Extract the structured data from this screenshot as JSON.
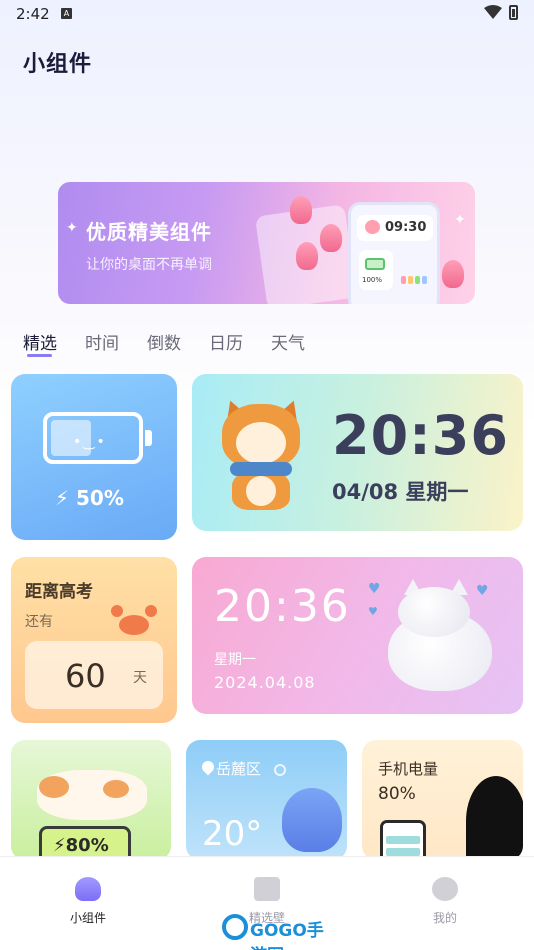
{
  "status_bar": {
    "time": "2:42",
    "notif_icon": "A"
  },
  "page": {
    "title": "小组件"
  },
  "banner": {
    "title": "优质精美组件",
    "subtitle": "让你的桌面不再单调",
    "preview_time": "09:30",
    "preview_battery": "100%"
  },
  "tabs": [
    {
      "label": "精选",
      "active": true
    },
    {
      "label": "时间",
      "active": false
    },
    {
      "label": "倒数",
      "active": false
    },
    {
      "label": "日历",
      "active": false
    },
    {
      "label": "天气",
      "active": false
    }
  ],
  "widgets": {
    "battery": {
      "face": "•‿•",
      "label": "⚡ 50%"
    },
    "clock": {
      "time": "20:36",
      "date": "04/08 星期一"
    },
    "countdown": {
      "title": "距离高考",
      "still": "还有",
      "number": "60",
      "unit": "天"
    },
    "pink_clock": {
      "time": "20:36",
      "weekday": "星期一",
      "date": "2024.04.08"
    },
    "cat_battery": {
      "label": "⚡80%"
    },
    "weather": {
      "location": "岳麓区",
      "temp": "20°"
    },
    "phone_battery": {
      "title": "手机电量",
      "percent": "80%"
    }
  },
  "bottom_nav": [
    {
      "label": "小组件",
      "icon": "widget-icon",
      "active": true
    },
    {
      "label": "精选壁",
      "icon": "wallpaper-icon",
      "active": false
    },
    {
      "label": "我的",
      "icon": "profile-icon",
      "active": false
    }
  ],
  "watermark": {
    "text": "GOGO手游网"
  },
  "colors": {
    "accent": "#8a7cf0",
    "title": "#1c1c3a"
  }
}
